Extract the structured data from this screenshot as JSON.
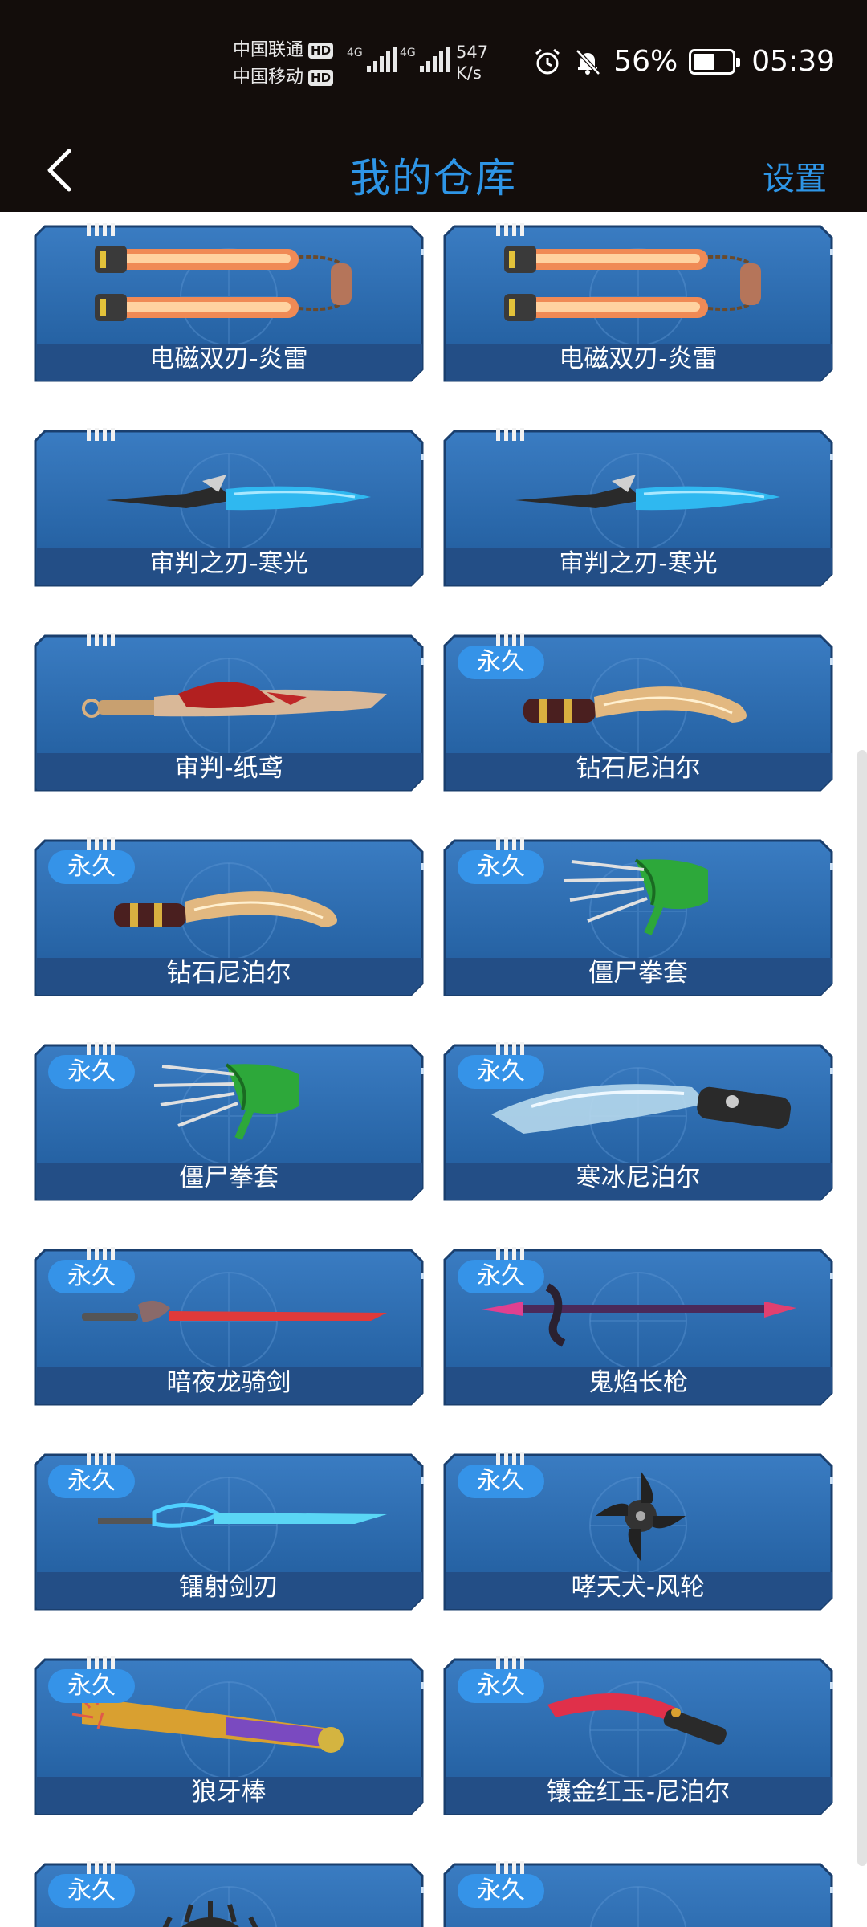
{
  "status_bar": {
    "carrier1": "中国联通",
    "carrier2": "中国移动",
    "hd": "HD",
    "net1": "4G",
    "net2": "4G",
    "speed_value": "547",
    "speed_unit": "K/s",
    "battery": "56%",
    "time": "05:39"
  },
  "nav": {
    "title": "我的仓库",
    "settings": "设置"
  },
  "badge_label": "永久",
  "items": [
    {
      "name": "电磁双刃-炎雷",
      "permanent": false,
      "weapon": "twin-blades-icon"
    },
    {
      "name": "电磁双刃-炎雷",
      "permanent": false,
      "weapon": "twin-blades-icon"
    },
    {
      "name": "审判之刃-寒光",
      "permanent": false,
      "weapon": "ice-blade-icon"
    },
    {
      "name": "审判之刃-寒光",
      "permanent": false,
      "weapon": "ice-blade-icon"
    },
    {
      "name": "审判-纸鸢",
      "permanent": false,
      "weapon": "red-sword-icon"
    },
    {
      "name": "钻石尼泊尔",
      "permanent": true,
      "weapon": "kukri-icon"
    },
    {
      "name": "钻石尼泊尔",
      "permanent": true,
      "weapon": "kukri-icon"
    },
    {
      "name": "僵尸拳套",
      "permanent": true,
      "weapon": "claw-glove-icon"
    },
    {
      "name": "僵尸拳套",
      "permanent": true,
      "weapon": "claw-glove-icon"
    },
    {
      "name": "寒冰尼泊尔",
      "permanent": true,
      "weapon": "ice-kukri-icon"
    },
    {
      "name": "暗夜龙骑剑",
      "permanent": true,
      "weapon": "dragon-sword-icon"
    },
    {
      "name": "鬼焰长枪",
      "permanent": true,
      "weapon": "spear-icon"
    },
    {
      "name": "镭射剑刃",
      "permanent": true,
      "weapon": "laser-blade-icon"
    },
    {
      "name": "哮天犬-风轮",
      "permanent": true,
      "weapon": "shuriken-icon"
    },
    {
      "name": "狼牙棒",
      "permanent": true,
      "weapon": "spiked-bat-icon"
    },
    {
      "name": "镶金红玉-尼泊尔",
      "permanent": true,
      "weapon": "ruby-kukri-icon"
    },
    {
      "name": "",
      "permanent": true,
      "weapon": "spiked-mace-icon"
    },
    {
      "name": "",
      "permanent": true,
      "weapon": "golden-blade-icon"
    }
  ]
}
